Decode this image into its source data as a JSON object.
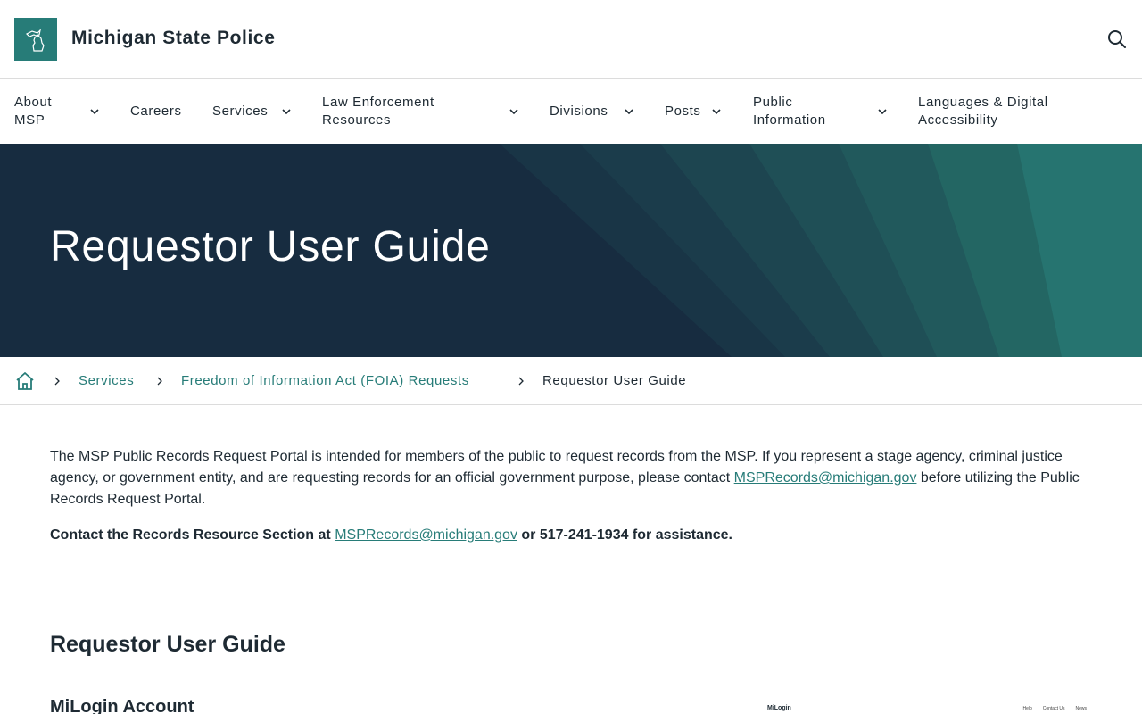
{
  "header": {
    "site_title": "Michigan State Police",
    "logo_icon": "michigan-map-icon",
    "search_icon": "search-icon"
  },
  "nav": {
    "items": [
      {
        "label": "About MSP",
        "has_dropdown": true
      },
      {
        "label": "Careers",
        "has_dropdown": false
      },
      {
        "label": "Services",
        "has_dropdown": true
      },
      {
        "label": "Law Enforcement Resources",
        "has_dropdown": true
      },
      {
        "label": "Divisions",
        "has_dropdown": true
      },
      {
        "label": "Posts",
        "has_dropdown": true
      },
      {
        "label": "Public Information",
        "has_dropdown": true
      },
      {
        "label": "Languages & Digital Accessibility",
        "has_dropdown": false
      }
    ]
  },
  "hero": {
    "title": "Requestor User Guide"
  },
  "breadcrumb": {
    "home_icon": "home-icon",
    "items": [
      {
        "label": "Services"
      },
      {
        "label": "Freedom of Information Act (FOIA) Requests"
      },
      {
        "label": "Requestor User Guide"
      }
    ]
  },
  "content": {
    "intro_text": "The MSP Public Records Request Portal is intended for members of the public to request records from the MSP. If you represent a stage agency, criminal justice agency, or government entity, and are requesting records for an official government purpose, please contact",
    "intro_email": "MSPRecords@michigan.gov",
    "intro_tail": " before utilizing the Public Records Request Portal.",
    "contact_prefix": "Contact the Records Resource Section at ",
    "contact_email": "MSPRecords@michigan.gov",
    "contact_suffix": " or 517-241-1934 for assistance.",
    "heading": "Requestor User Guide",
    "subheading": "MiLogin Account"
  },
  "preview": {
    "brand": "MiLogin",
    "links": [
      "Help",
      "Contact Us",
      "News"
    ]
  },
  "colors": {
    "brand_teal": "#277c78",
    "hero_navy": "#172c40",
    "text": "#1e2a33"
  }
}
